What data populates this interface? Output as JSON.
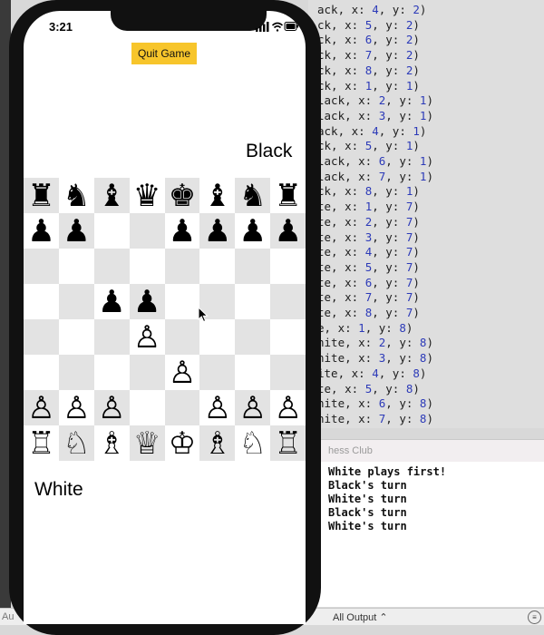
{
  "app": {
    "status_time": "3:21",
    "quit_label": "Quit Game",
    "black_label": "Black",
    "white_label": "White"
  },
  "board": {
    "rows": [
      [
        "♜",
        "♞",
        "♝",
        "♛",
        "♚",
        "♝",
        "♞",
        "♜"
      ],
      [
        "♟",
        "♟",
        "",
        "",
        "♟",
        "♟",
        "♟",
        "♟"
      ],
      [
        "",
        "",
        "",
        "",
        "",
        "",
        "",
        ""
      ],
      [
        "",
        "",
        "♟",
        "♟",
        "",
        "",
        "",
        ""
      ],
      [
        "",
        "",
        "",
        "♙",
        "",
        "",
        "",
        ""
      ],
      [
        "",
        "",
        "",
        "",
        "♙",
        "",
        "",
        ""
      ],
      [
        "♙",
        "♙",
        "♙",
        "",
        "",
        "♙",
        "♙",
        "♙"
      ],
      [
        "♖",
        "♘",
        "♗",
        "♕",
        "♔",
        "♗",
        "♘",
        "♖"
      ]
    ]
  },
  "xcode": {
    "code_lines": [
      "ack, x: 4, y: 2)",
      "ck, x: 5, y: 2)",
      "ck, x: 6, y: 2)",
      "ck, x: 7, y: 2)",
      "ck, x: 8, y: 2)",
      "ck, x: 1, y: 1)",
      "lack, x: 2, y: 1)",
      "lack, x: 3, y: 1)",
      "ack, x: 4, y: 1)",
      "ck, x: 5, y: 1)",
      "lack, x: 6, y: 1)",
      "lack, x: 7, y: 1)",
      "ck, x: 8, y: 1)",
      "te, x: 1, y: 7)",
      "te, x: 2, y: 7)",
      "te, x: 3, y: 7)",
      "te, x: 4, y: 7)",
      "te, x: 5, y: 7)",
      "te, x: 6, y: 7)",
      "te, x: 7, y: 7)",
      "te, x: 8, y: 7)",
      "e, x: 1, y: 8)",
      "hite, x: 2, y: 8)",
      "hite, x: 3, y: 8)",
      "ite, x: 4, y: 8)",
      "te, x: 5, y: 8)",
      "hite, x: 6, y: 8)",
      "hite, x: 7, y: 8)",
      "ite, x: 8, y: 8)"
    ],
    "console_header": "hess Club",
    "console_lines": [
      "White plays first!",
      "Black's turn",
      "White's turn",
      "Black's turn",
      "White's turn"
    ],
    "output_selector": "All Output ⌃",
    "bottom_left": "Au"
  }
}
